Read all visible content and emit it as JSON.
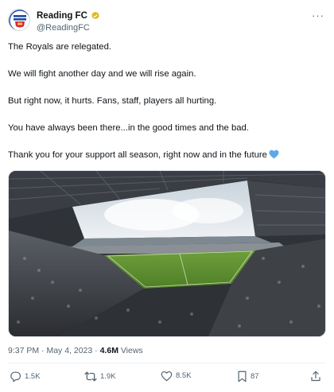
{
  "account": {
    "display_name": "Reading FC",
    "handle": "@ReadingFC"
  },
  "tweet": {
    "paragraphs": [
      "The Royals are relegated.",
      "We will fight another day and we will rise again.",
      "But right now, it hurts. Fans, staff, players all hurting.",
      "You have always been there...in the good times and the bad.",
      "Thank you for your support all season, right now and in the future"
    ],
    "time": "9:37 PM",
    "date": "May 4, 2023",
    "separator": "·",
    "views_count": "4.6M",
    "views_label": "Views"
  },
  "actions": {
    "replies": "1.5K",
    "reposts": "1.9K",
    "likes": "8.5K",
    "bookmarks": "87"
  },
  "colors": {
    "verified_badge": "#e2b719",
    "heart_emoji": "#5da9e9",
    "secondary_text": "#536471",
    "primary_text": "#0f1419"
  }
}
